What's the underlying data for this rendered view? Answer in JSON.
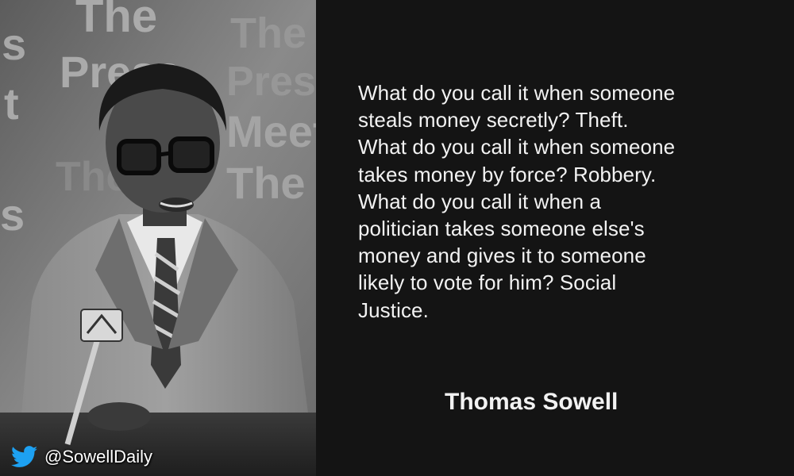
{
  "quote": {
    "text": "What do you call it when someone\nsteals money secretly? Theft.\nWhat do you call it when someone\ntakes money by force? Robbery.\nWhat do you call it when a\npolitician takes someone else's\nmoney and gives it to someone\nlikely to vote for him? Social\nJustice.",
    "author": "Thomas Sowell"
  },
  "attribution": {
    "handle": "@SowellDaily",
    "icon": "twitter-bird-icon",
    "icon_color": "#1da1f2"
  },
  "photo": {
    "background_text": [
      "The",
      "Press",
      "Meet",
      "The"
    ],
    "side_letters": [
      "s",
      "t",
      "s"
    ]
  },
  "colors": {
    "background": "#141414",
    "text": "#f2f2f2"
  }
}
